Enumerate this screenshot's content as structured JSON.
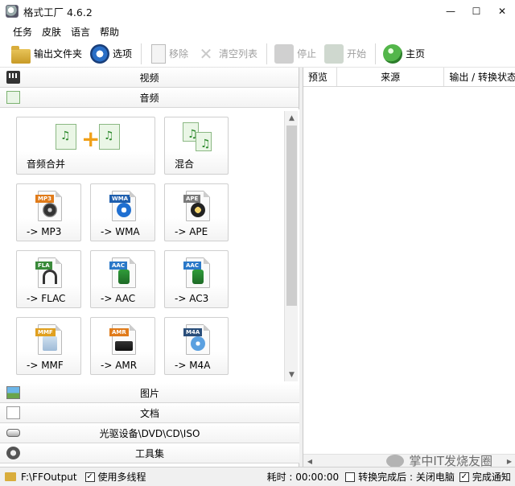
{
  "window": {
    "title": "格式工厂 4.6.2",
    "minimize": "—",
    "maximize": "☐",
    "close": "✕"
  },
  "menu": [
    "任务",
    "皮肤",
    "语言",
    "帮助"
  ],
  "toolbar": {
    "output_folder": "输出文件夹",
    "options": "选项",
    "remove": "移除",
    "clear_list": "清空列表",
    "stop": "停止",
    "start": "开始",
    "home": "主页"
  },
  "categories": {
    "video": "视频",
    "audio": "音频",
    "image": "图片",
    "document": "文档",
    "disc": "光驱设备\\DVD\\CD\\ISO",
    "tools": "工具集"
  },
  "audio_tiles": [
    {
      "label": "音频合并"
    },
    {
      "label": "混合"
    },
    {
      "label": "-> MP3",
      "badge": "MP3",
      "badge_color": "#e07b1a"
    },
    {
      "label": "-> WMA",
      "badge": "WMA",
      "badge_color": "#1f5fae"
    },
    {
      "label": "-> APE",
      "badge": "APE",
      "badge_color": "#7a7a7a"
    },
    {
      "label": "-> FLAC",
      "badge": "FLA",
      "badge_color": "#3a8a3a"
    },
    {
      "label": "-> AAC",
      "badge": "AAC",
      "badge_color": "#2a78c8"
    },
    {
      "label": "-> AC3",
      "badge": "AAC",
      "badge_color": "#2a78c8"
    },
    {
      "label": "-> MMF",
      "badge": "MMF",
      "badge_color": "#e0a020"
    },
    {
      "label": "-> AMR",
      "badge": "AMR",
      "badge_color": "#e07b1a"
    },
    {
      "label": "-> M4A",
      "badge": "M4A",
      "badge_color": "#2a4e7a"
    }
  ],
  "task_list": {
    "columns": [
      "预览",
      "来源",
      "输出 / 转换状态"
    ]
  },
  "status": {
    "output_path": "F:\\FFOutput",
    "multithread": "使用多线程",
    "elapsed_label": "耗时 : 00:00:00",
    "after_convert": "转换完成后 : 关闭电脑",
    "notify": "完成通知"
  },
  "watermark": "掌中IT发烧友圈"
}
